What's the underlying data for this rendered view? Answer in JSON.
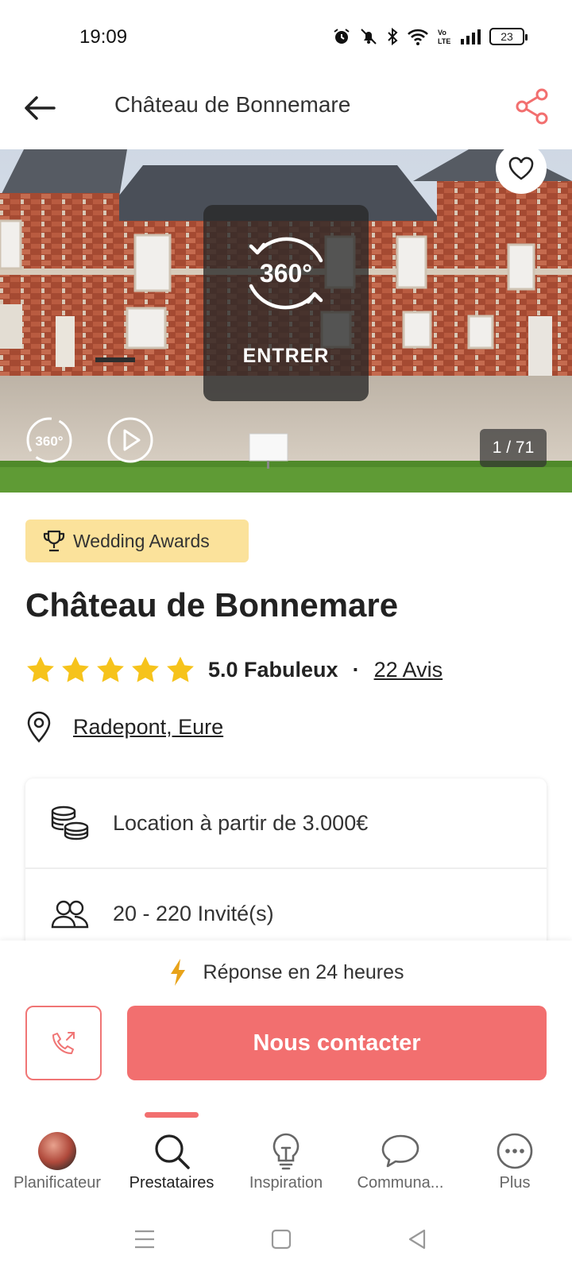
{
  "status_bar": {
    "time": "19:09",
    "battery": "23"
  },
  "header": {
    "title": "Château de Bonnemare"
  },
  "hero": {
    "tour_label": "ENTRER",
    "tour_badge": "360°",
    "mini_badge": "360°",
    "counter": "1 / 71"
  },
  "award": {
    "label": "Wedding Awards"
  },
  "venue": {
    "name": "Château de Bonnemare",
    "rating_text": "5.0 Fabuleux",
    "separator": "·",
    "reviews": "22 Avis",
    "location": "Radepont, Eure",
    "stars": 5
  },
  "info": {
    "price": "Location à partir de 3.000€",
    "guests": "20 - 220 Invité(s)"
  },
  "actions": {
    "response": "Réponse en 24 heures",
    "contact_label": "Nous contacter"
  },
  "tabs": [
    {
      "label": "Planificateur"
    },
    {
      "label": "Prestataires"
    },
    {
      "label": "Inspiration"
    },
    {
      "label": "Communa..."
    },
    {
      "label": "Plus"
    }
  ],
  "colors": {
    "accent": "#f26f6f",
    "award_bg": "#fbe29b",
    "star": "#f6c31b"
  }
}
